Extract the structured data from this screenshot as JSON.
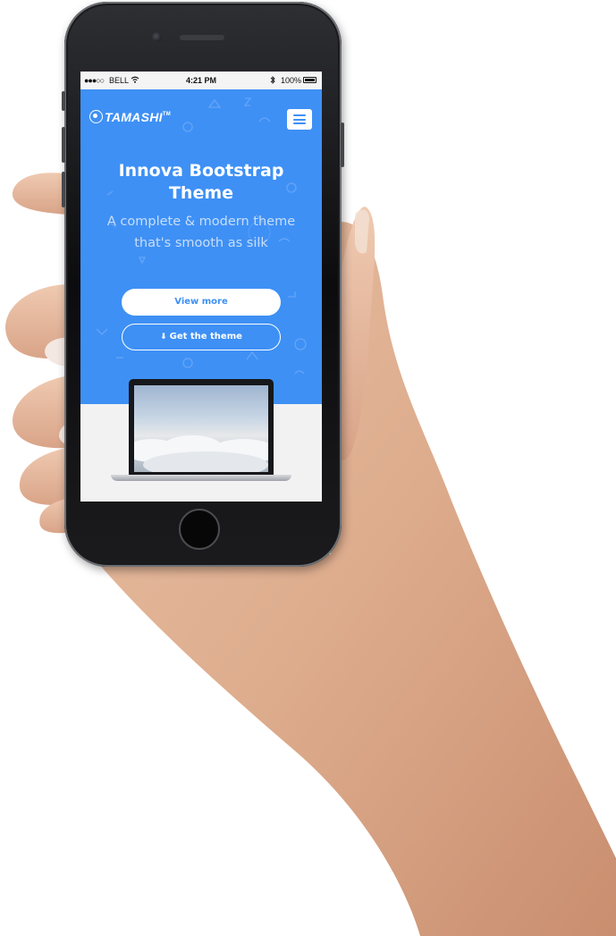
{
  "status_bar": {
    "signal": "●●●○○",
    "carrier": "BELL",
    "wifi_icon": "wifi-icon",
    "time": "4:21 PM",
    "bluetooth_icon": "bluetooth-icon",
    "battery_percent": "100%",
    "battery_icon": "battery-icon"
  },
  "header": {
    "logo_text": "TAMASHI",
    "logo_tm": "TM",
    "menu_icon": "hamburger-menu-icon"
  },
  "hero": {
    "title": "Innova Bootstrap Theme",
    "subtitle": "A complete & modern theme that's smooth as silk",
    "view_more_label": "View more",
    "get_theme_label": "Get the theme",
    "get_theme_icon": "download-icon"
  },
  "colors": {
    "hero_blue": "#3e90f5",
    "white": "#ffffff",
    "phone_body": "#1b1b1d"
  }
}
